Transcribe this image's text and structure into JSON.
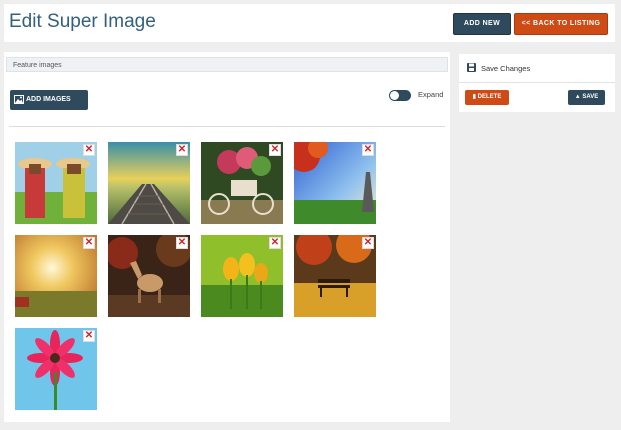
{
  "header": {
    "title": "Edit Super Image",
    "add_new_label": "ADD NEW",
    "back_label": "<< BACK TO LISTING"
  },
  "main": {
    "feature_label": "Feature images",
    "add_images_label": "ADD IMAGES",
    "expand_label": "Expand",
    "expand_on": false,
    "remove_glyph": "✕",
    "images": [
      {
        "subject": "children-in-meadow"
      },
      {
        "subject": "railway-sunset"
      },
      {
        "subject": "bicycle-flower-cart"
      },
      {
        "subject": "autumn-eiffel-tower"
      },
      {
        "subject": "sunrise-field"
      },
      {
        "subject": "horse-in-forest"
      },
      {
        "subject": "yellow-tulips"
      },
      {
        "subject": "autumn-park-bench"
      },
      {
        "subject": "pink-gerbera"
      }
    ]
  },
  "sidebar": {
    "title": "Save Changes",
    "delete_label": "DELETE",
    "save_label": "SAVE"
  },
  "colors": {
    "primary": "#2e4a5c",
    "danger": "#cf4b16",
    "title": "#33607e"
  }
}
